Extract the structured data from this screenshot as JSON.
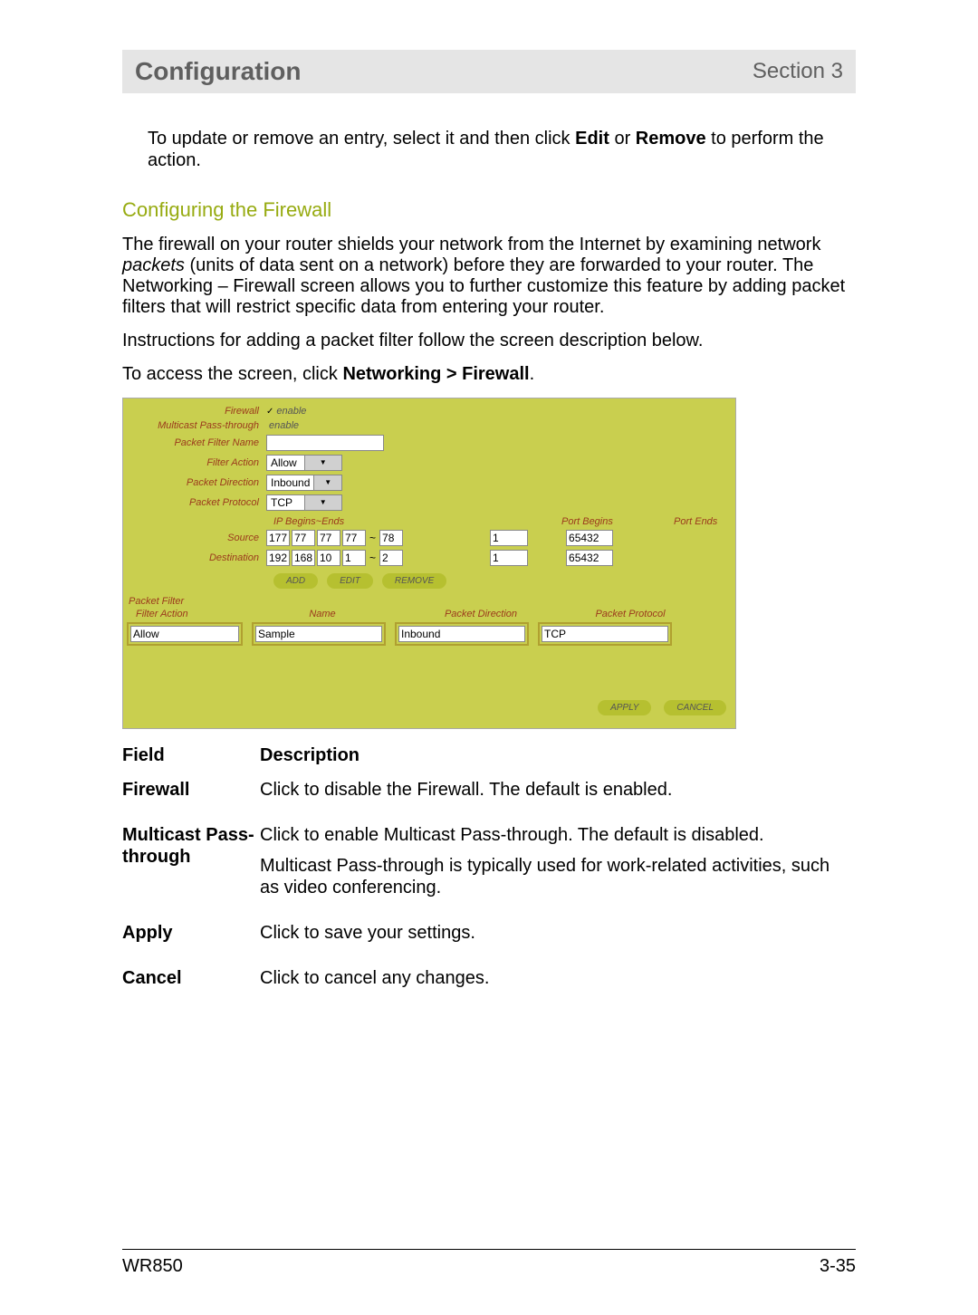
{
  "header": {
    "chapter": "Configuration",
    "section": "Section 3"
  },
  "intro": {
    "pre": "To update or remove an entry, select it and then click ",
    "b1": "Edit",
    "mid": " or ",
    "b2": "Remove",
    "post": " to perform the action."
  },
  "subhead": "Configuring the Firewall",
  "para1": {
    "a": "The firewall on your router shields your network from the Internet by examining network ",
    "i": "packets",
    "b": " (units of data sent on a network) before they are forwarded to your router. The Networking – Firewall screen allows you to further customize this feature by adding packet filters that will restrict specific data from entering your router."
  },
  "para2": "Instructions for adding a packet filter follow the screen description below.",
  "para3": {
    "a": "To access the screen, click ",
    "b": "Networking > Firewall",
    "c": "."
  },
  "shot": {
    "labels": {
      "firewall": "Firewall",
      "multicast": "Multicast Pass-through",
      "pfname": "Packet Filter Name",
      "faction": "Filter Action",
      "pdirection": "Packet Direction",
      "pprotocol": "Packet Protocol",
      "ipheads": "IP Begins~Ends",
      "portbegins": "Port Begins",
      "portends": "Port Ends",
      "source": "Source",
      "destination": "Destination",
      "enable": "enable"
    },
    "values": {
      "firewall_checked": "✓",
      "faction": "Allow",
      "pdirection": "Inbound",
      "pprotocol": "TCP",
      "src": {
        "o1": "177",
        "o2": "77",
        "o3": "77",
        "o4": "77",
        "end": "78",
        "p1": "1",
        "p2": "65432"
      },
      "dst": {
        "o1": "192",
        "o2": "168",
        "o3": "10",
        "o4": "1",
        "end": "2",
        "p1": "1",
        "p2": "65432"
      }
    },
    "buttons": {
      "add": "ADD",
      "edit": "EDIT",
      "remove": "REMOVE",
      "apply": "APPLY",
      "cancel": "CANCEL"
    },
    "filter_section": {
      "title": "Packet Filter",
      "cols": {
        "c1": "Filter Action",
        "c2": "Name",
        "c3": "Packet Direction",
        "c4": "Packet Protocol"
      },
      "row": {
        "action": "Allow",
        "name": "Sample",
        "direction": "Inbound",
        "protocol": "TCP"
      }
    }
  },
  "table": {
    "head": {
      "c1": "Field",
      "c2": "Description"
    },
    "rows": [
      {
        "f": "Firewall",
        "d": [
          "Click to disable the Firewall. The default is enabled."
        ]
      },
      {
        "f": "Multicast Pass-through",
        "d": [
          "Click to enable Multicast Pass-through. The default is disabled.",
          "Multicast Pass-through is typically used for work-related activities, such as video conferencing."
        ]
      },
      {
        "f": "Apply",
        "d": [
          "Click to save your settings."
        ]
      },
      {
        "f": "Cancel",
        "d": [
          "Click to cancel any changes."
        ]
      }
    ]
  },
  "footer": {
    "model": "WR850",
    "page": "3-35"
  }
}
